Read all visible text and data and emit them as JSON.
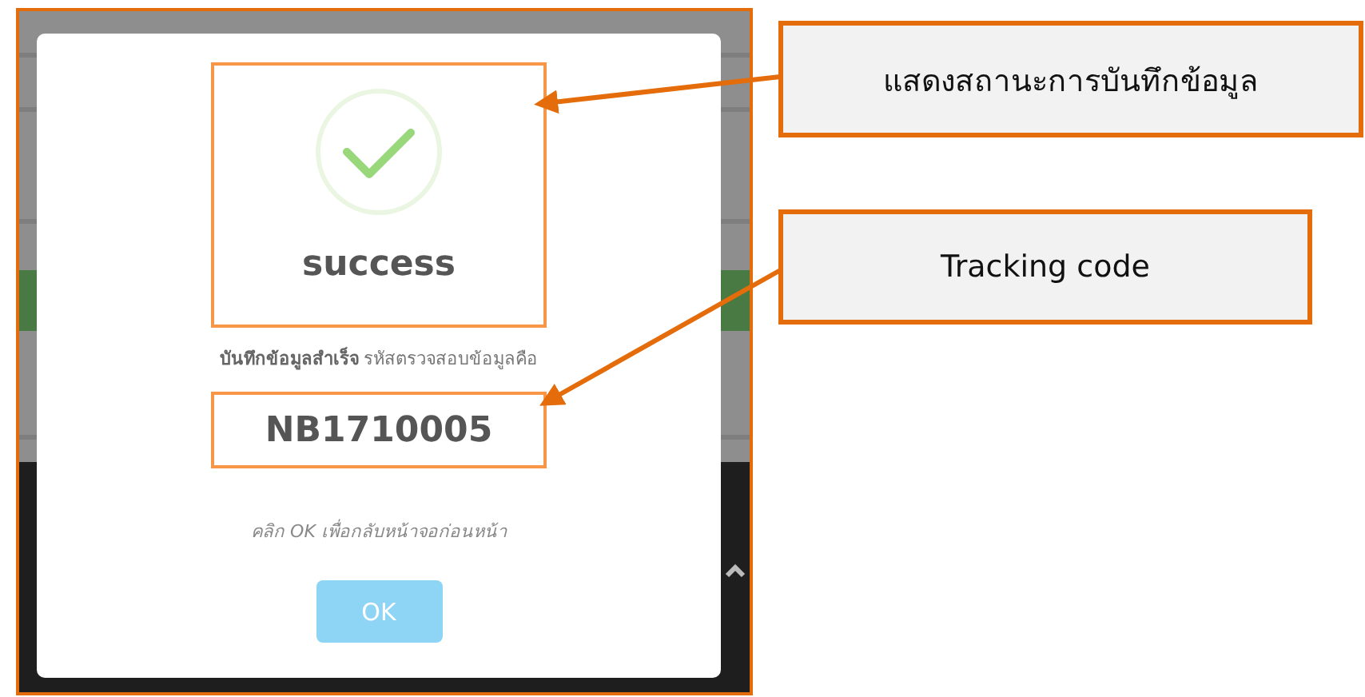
{
  "dialog": {
    "title": "success",
    "message": "**บันทึกข้อมูลสำเร็จ** รหัสตรวจสอบข้อมูลคือ",
    "code": "NB1710005",
    "hint": "คลิก OK เพื่อกลับหน้าจอก่อนหน้า",
    "button": "OK"
  },
  "callouts": [
    {
      "text": "แสดงสถานะการบันทึกข้อมูล"
    },
    {
      "text": "Tracking code"
    }
  ]
}
